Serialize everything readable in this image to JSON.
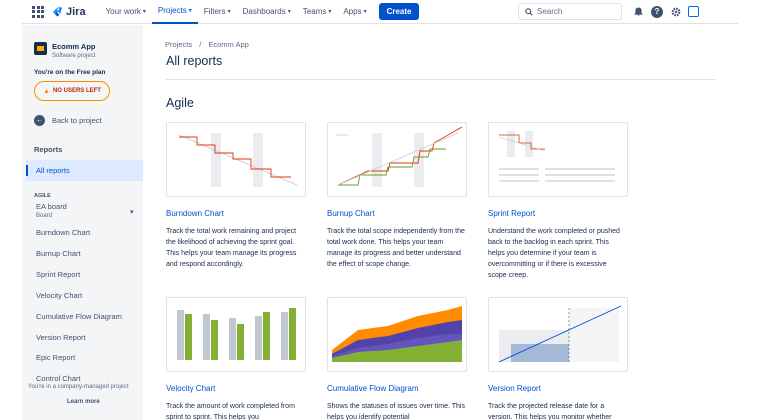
{
  "nav": {
    "product": "Jira",
    "items": [
      "Your work",
      "Projects",
      "Filters",
      "Dashboards",
      "Teams",
      "Apps"
    ],
    "create": "Create",
    "search_placeholder": "Search",
    "active_item": "Projects",
    "accent": "#0052cc"
  },
  "sidebar": {
    "project_name": "Ecomm App",
    "project_type": "Software project",
    "plan_text": "You're on the Free plan",
    "no_users": "NO USERS LEFT",
    "back": "Back to project",
    "reports_heading": "Reports",
    "all_reports": "All reports",
    "agile_heading": "AGILE",
    "board_name": "EA board",
    "board_sub": "Board",
    "items": [
      "Burndown Chart",
      "Burnup Chart",
      "Sprint Report",
      "Velocity Chart",
      "Cumulative Flow Diagram",
      "Version Report",
      "Epic Report",
      "Control Chart"
    ],
    "footer": "You're in a company-managed project",
    "learn_more": "Learn more"
  },
  "main": {
    "breadcrumb": [
      "Projects",
      "Ecomm App"
    ],
    "breadcrumb_sep": "/",
    "title": "All reports",
    "section": "Agile",
    "cards": [
      {
        "title": "Burndown Chart",
        "desc": "Track the total work remaining and project the likelihood of achieving the sprint goal. This helps your team manage its progress and respond accordingly."
      },
      {
        "title": "Burnup Chart",
        "desc": "Track the total scope independently from the total work done. This helps your team manage its progress and better understand the effect of scope change."
      },
      {
        "title": "Sprint Report",
        "desc": "Understand the work completed or pushed back to the backlog in each sprint. This helps you determine if your team is overcommitting or if there is excessive scope creep."
      },
      {
        "title": "Velocity Chart",
        "desc": "Track the amount of work completed from sprint to sprint. This helps you"
      },
      {
        "title": "Cumulative Flow Diagram",
        "desc": "Shows the statuses of issues over time. This helps you identify potential"
      },
      {
        "title": "Version Report",
        "desc": "Track the projected release date for a version. This helps you monitor whether"
      }
    ]
  }
}
